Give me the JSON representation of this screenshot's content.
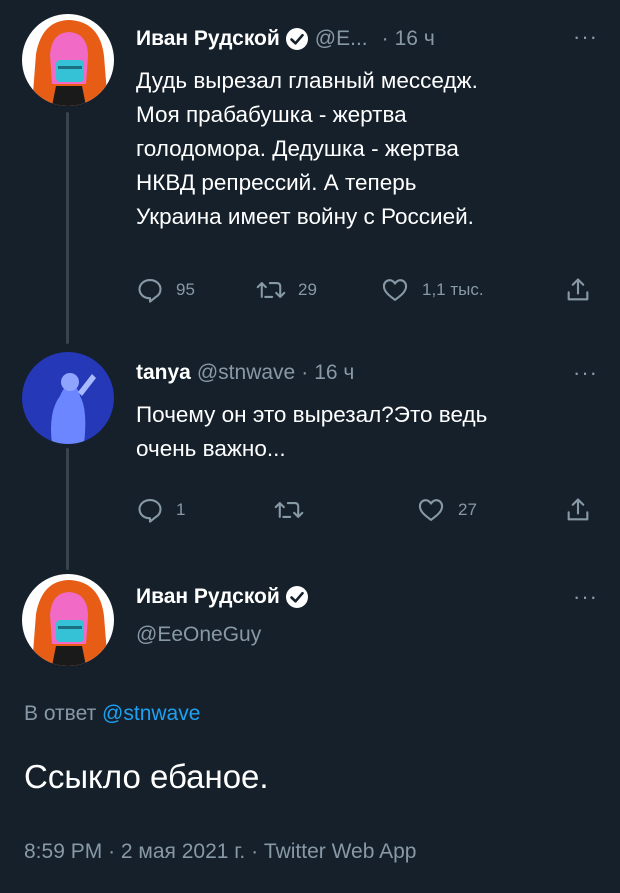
{
  "tweets": [
    {
      "name": "Иван Рудской",
      "handle": "@E...",
      "separator": "·",
      "time": "16 ч",
      "more": "···",
      "lines": [
        "Дудь вырезал главный месседж.",
        "Моя прабабушка - жертва",
        "голодомора. Дедушка - жертва",
        "НКВД репрессий. А теперь",
        "Украина имеет войну с Россией."
      ],
      "replies": "95",
      "retweets": "29",
      "likes": "1,1 тыс.",
      "avatar_icon": "orange-hood-avatar"
    },
    {
      "name": "tanya",
      "handle": "@stnwave",
      "separator": "·",
      "time": "16 ч",
      "more": "···",
      "lines": [
        "Почему он это вырезал?Это ведь",
        "очень важно..."
      ],
      "replies": "1",
      "retweets": "",
      "likes": "27",
      "avatar_icon": "blue-figure-avatar"
    }
  ],
  "main_tweet": {
    "name": "Иван Рудской",
    "handle": "@EeOneGuy",
    "more": "···",
    "reply_prefix": "В ответ",
    "reply_mention": "@stnwave",
    "text": "Ссыкло ебаное.",
    "time": "8:59 PM",
    "sep1": "·",
    "date": "2 мая 2021 г.",
    "sep2": "·",
    "source": "Twitter Web App"
  },
  "colors": {
    "background": "#15202b",
    "secondary_text": "#8899a6",
    "link": "#1da1f2",
    "thread_line": "#38444d"
  },
  "icons": [
    "reply-icon",
    "retweet-icon",
    "like-icon",
    "share-icon",
    "verified-icon",
    "more-icon"
  ]
}
